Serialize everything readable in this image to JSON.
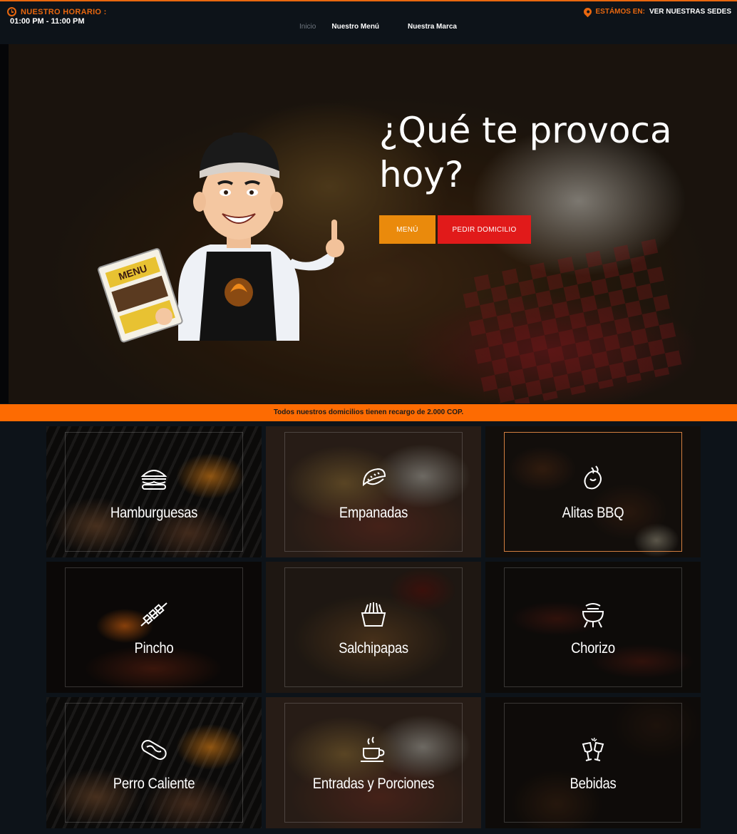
{
  "header": {
    "hours_label": "NUESTRO  HORARIO :",
    "hours_value": "01:00 PM - 11:00 PM",
    "nav": [
      "Inicio",
      "Nuestro Menú",
      "Nuestra Marca"
    ],
    "sedes_label": "ESTÁMOS EN:",
    "sedes_link": "VER NUESTRAS SEDES",
    "accent_color": "#e8670f"
  },
  "hero": {
    "title": "¿Qué te provoca hoy?",
    "menu_button": "MENÚ",
    "delivery_button": "PEDIR DOMICILIO",
    "menu_button_color": "#ea8a0c",
    "delivery_button_color": "#e11a1a",
    "mascot_sign": "MENU"
  },
  "notice": {
    "text": "Todos nuestros domicilios tienen recargo de 2.000 COP.",
    "color": "#fd6b02"
  },
  "categories": [
    {
      "name": "Hamburguesas",
      "icon": "burger-icon"
    },
    {
      "name": "Empanadas",
      "icon": "empanada-icon"
    },
    {
      "name": "Alitas BBQ",
      "icon": "chicken-wing-icon"
    },
    {
      "name": "Pincho",
      "icon": "skewer-icon"
    },
    {
      "name": "Salchipapas",
      "icon": "fries-icon"
    },
    {
      "name": "Chorizo",
      "icon": "grill-icon"
    },
    {
      "name": "Perro Caliente",
      "icon": "hotdog-icon"
    },
    {
      "name": "Entradas y Porciones",
      "icon": "coffee-cup-icon"
    },
    {
      "name": "Bebidas",
      "icon": "wine-glasses-icon"
    }
  ]
}
